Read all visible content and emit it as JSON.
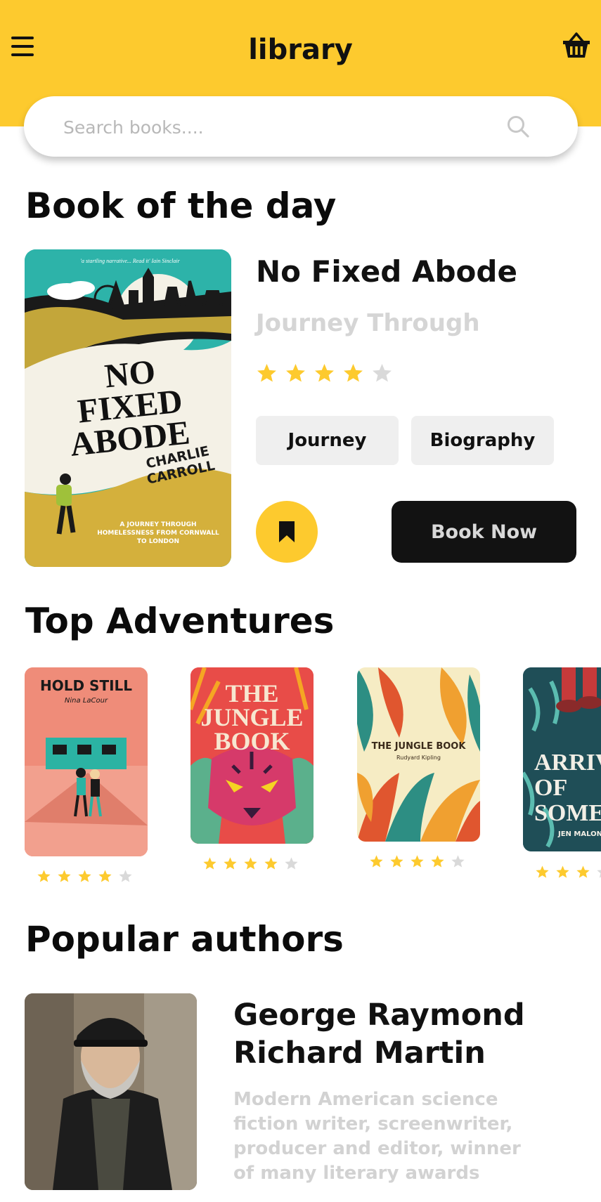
{
  "header": {
    "title": "library",
    "menu_icon": "hamburger-menu-icon",
    "basket_icon": "basket-icon",
    "background_color": "#fdca2e"
  },
  "search": {
    "placeholder": "Search books....",
    "value": "",
    "icon": "search-icon"
  },
  "book_of_the_day": {
    "section_title": "Book of the day",
    "title": "No Fixed Abode",
    "subtitle": "Journey Through",
    "rating": 4,
    "rating_max": 5,
    "tags": [
      "Journey",
      "Biography"
    ],
    "bookmark_icon": "bookmark-icon",
    "book_now_label": "Book Now",
    "cover": {
      "quote": "'a startling narrative... Read it' Iain Sinclair",
      "title_lines": [
        "NO",
        "FIXED",
        "ABODE"
      ],
      "author_lines": [
        "CHARLIE",
        "CARROLL"
      ],
      "tagline": "A JOURNEY THROUGH HOMELESSNESS FROM CORNWALL TO LONDON"
    }
  },
  "top_adventures": {
    "section_title": "Top Adventures",
    "books": [
      {
        "cover_text": "HOLD STILL",
        "cover_author": "Nina LaCour",
        "rating": 4
      },
      {
        "cover_text": "THE JUNGLE BOOK",
        "cover_author": "",
        "rating": 4
      },
      {
        "cover_text": "THE JUNGLE BOOK",
        "cover_author": "Rudyard Kipling",
        "rating": 4
      },
      {
        "cover_text": "ARRIV OF SOME",
        "cover_author": "JEN MALON",
        "rating": 3
      }
    ]
  },
  "popular_authors": {
    "section_title": "Popular authors",
    "authors": [
      {
        "name": "George Raymond Richard Martin",
        "bio": "Modern American science fiction writer, screenwriter, producer and editor, winner of many literary awards"
      }
    ]
  },
  "colors": {
    "accent": "#fdca2e",
    "star_filled": "#fdca2e",
    "star_empty": "#d9d9d9",
    "chip_bg": "#efefef",
    "button_dark": "#121212",
    "muted_text": "#d2d2d2"
  }
}
